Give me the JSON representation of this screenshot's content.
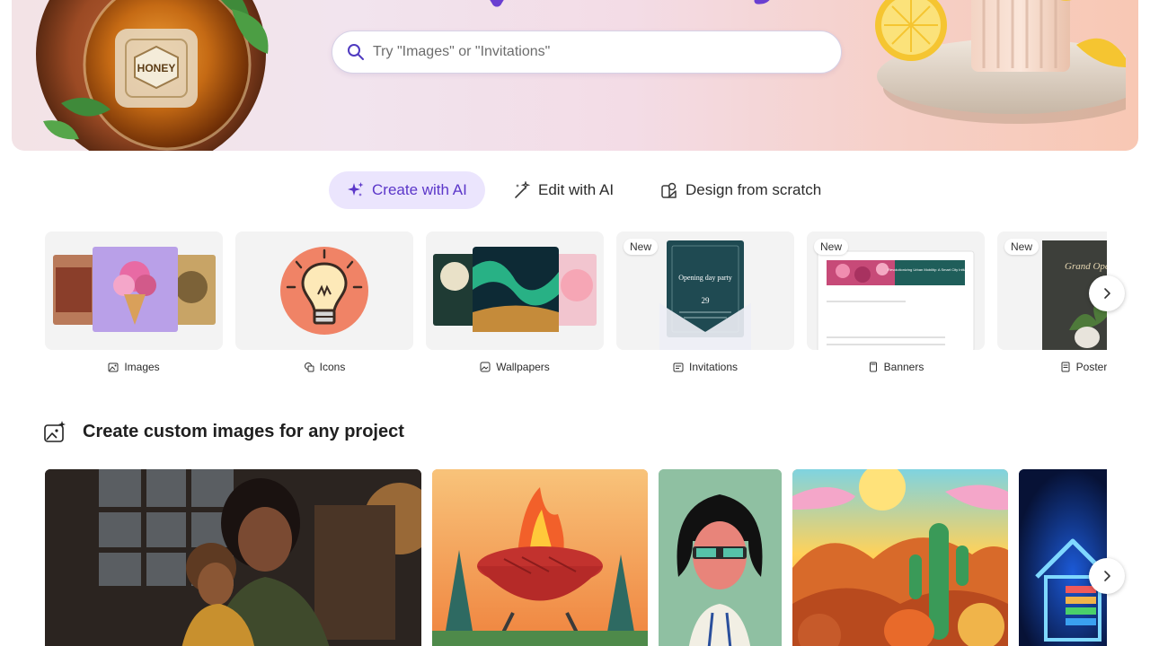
{
  "hero": {
    "search": {
      "placeholder": "Try \"Images\" or \"Invitations\""
    },
    "honey_jar_text": "HONEY"
  },
  "mode_tabs": [
    {
      "label": "Create with AI",
      "icon": "sparkle-icon",
      "active": true
    },
    {
      "label": "Edit with AI",
      "icon": "magic-wand-icon",
      "active": false
    },
    {
      "label": "Design from scratch",
      "icon": "shapes-icon",
      "active": false
    }
  ],
  "categories": [
    {
      "label": "Images",
      "icon": "image-icon",
      "badge": ""
    },
    {
      "label": "Icons",
      "icon": "icon-shapes-icon",
      "badge": ""
    },
    {
      "label": "Wallpapers",
      "icon": "wallpaper-icon",
      "badge": ""
    },
    {
      "label": "Invitations",
      "icon": "invitation-icon",
      "badge": "New",
      "preview": {
        "title": "Opening day party",
        "day": "29"
      }
    },
    {
      "label": "Banners",
      "icon": "banner-icon",
      "badge": "New",
      "preview": {
        "title": "Revolutionizing Urban Mobility: A Smart City Initiative"
      }
    },
    {
      "label": "Posters",
      "icon": "poster-icon",
      "badge": "New",
      "preview": {
        "title": "Grand Opening"
      }
    }
  ],
  "section": {
    "title": "Create custom images for any project",
    "icon": "image-sparkle-icon"
  },
  "colors": {
    "accent": "#5b36c9",
    "accent_bg": "#ebe5fd"
  }
}
